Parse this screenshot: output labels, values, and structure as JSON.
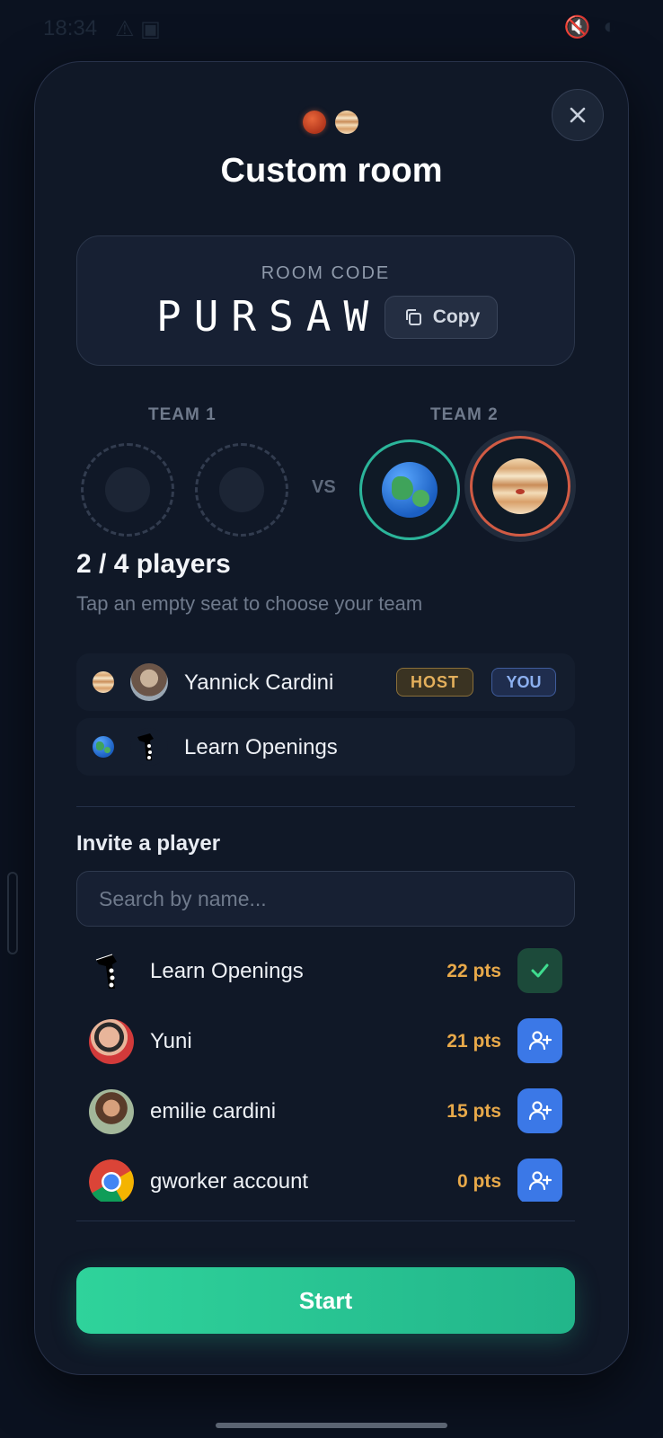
{
  "status": {
    "time": "18:34"
  },
  "modal": {
    "title": "Custom room",
    "close_label": "×"
  },
  "room": {
    "label": "ROOM CODE",
    "code": "PURSAW",
    "copy_label": "Copy"
  },
  "teams": {
    "team1_label": "TEAM 1",
    "team2_label": "TEAM 2",
    "vs_label": "VS"
  },
  "players": {
    "count_text": "2 / 4 players",
    "hint": "Tap an empty seat to choose your team",
    "list": [
      {
        "name": "Yannick Cardini",
        "planet": "jupiter",
        "host_badge": "HOST",
        "you_badge": "YOU"
      },
      {
        "name": "Learn Openings",
        "planet": "earth"
      }
    ]
  },
  "invite": {
    "title": "Invite a player",
    "search_placeholder": "Search by name...",
    "items": [
      {
        "name": "Learn Openings",
        "points": "22 pts",
        "status": "added",
        "icon": "check-icon"
      },
      {
        "name": "Yuni",
        "points": "21 pts",
        "status": "invite",
        "icon": "add-user-icon"
      },
      {
        "name": "emilie cardini",
        "points": "15 pts",
        "status": "invite",
        "icon": "add-user-icon"
      },
      {
        "name": "gworker account",
        "points": "0 pts",
        "status": "invite",
        "icon": "add-user-icon"
      }
    ]
  },
  "start_label": "Start",
  "colors": {
    "accent_green": "#2fd39b",
    "invite_blue": "#3b78e7",
    "points_orange": "#e8a94a",
    "team2_earth_ring": "#2bb59a",
    "team2_jupiter_ring": "#d15b44"
  }
}
